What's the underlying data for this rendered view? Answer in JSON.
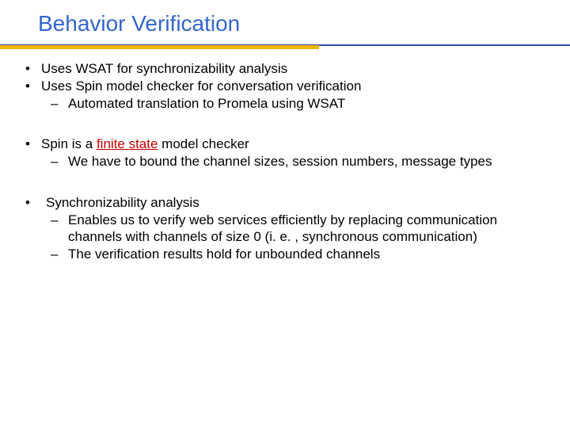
{
  "title": "Behavior Verification",
  "block1": {
    "b1": "Uses WSAT for synchronizability analysis",
    "b2": "Uses Spin model checker for conversation verification",
    "b2s1": "Automated translation to Promela using WSAT"
  },
  "block2": {
    "b1_pre": "Spin is a ",
    "b1_emph": "finite state",
    "b1_post": " model checker",
    "b1s1": "We have to bound the channel sizes, session numbers, message types"
  },
  "block3": {
    "b1": "Synchronizability analysis",
    "b1s1": "Enables us to verify web services efficiently by replacing communication channels with channels of size 0 (i. e. , synchronous communication)",
    "b1s2": "The verification results hold for unbounded channels"
  },
  "marks": {
    "bullet": "•",
    "dash": "–"
  }
}
